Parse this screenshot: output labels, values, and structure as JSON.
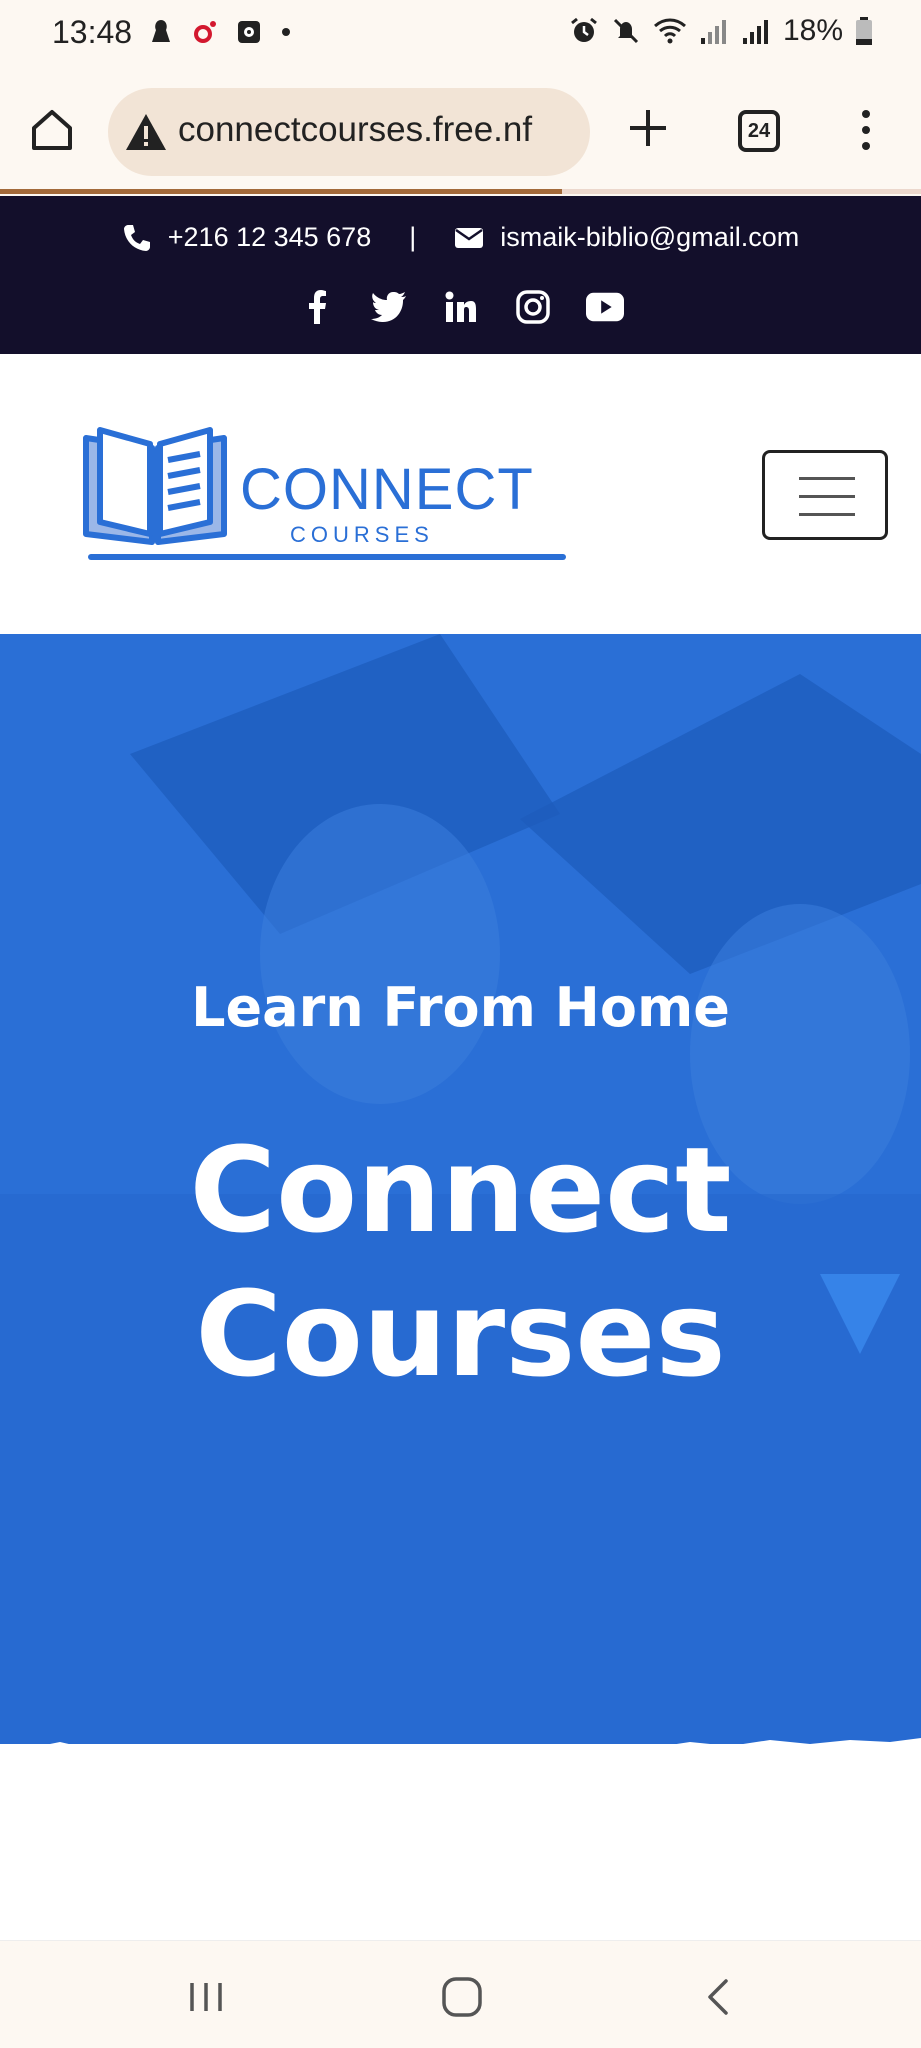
{
  "status_bar": {
    "time": "13:48",
    "battery": "18%",
    "icons": [
      "notification-icon",
      "music-app-icon",
      "screen-recorder-icon",
      "dot-icon",
      "alarm-icon",
      "mute-icon",
      "wifi-icon",
      "signal-icon",
      "signal-icon-2",
      "battery-icon"
    ]
  },
  "browser": {
    "url": "connectcourses.free.nf",
    "tab_count": "24",
    "load_progress": 0.61
  },
  "contact": {
    "phone": "+216 12 345 678",
    "separator": "|",
    "email": "ismaik-biblio@gmail.com",
    "socials": [
      "facebook-icon",
      "twitter-icon",
      "linkedin-icon",
      "instagram-icon",
      "youtube-icon"
    ]
  },
  "header": {
    "logo_title": "CONNECT",
    "logo_subtitle": "COURSES"
  },
  "hero": {
    "kicker": "Learn From Home",
    "title_line1": "Connect",
    "title_line2": "Courses"
  },
  "colors": {
    "brand_blue": "#2a6fd6",
    "topbar_bg": "#130f2b",
    "browser_bg": "#fdf8f2",
    "url_pill": "#f2e4d6"
  }
}
